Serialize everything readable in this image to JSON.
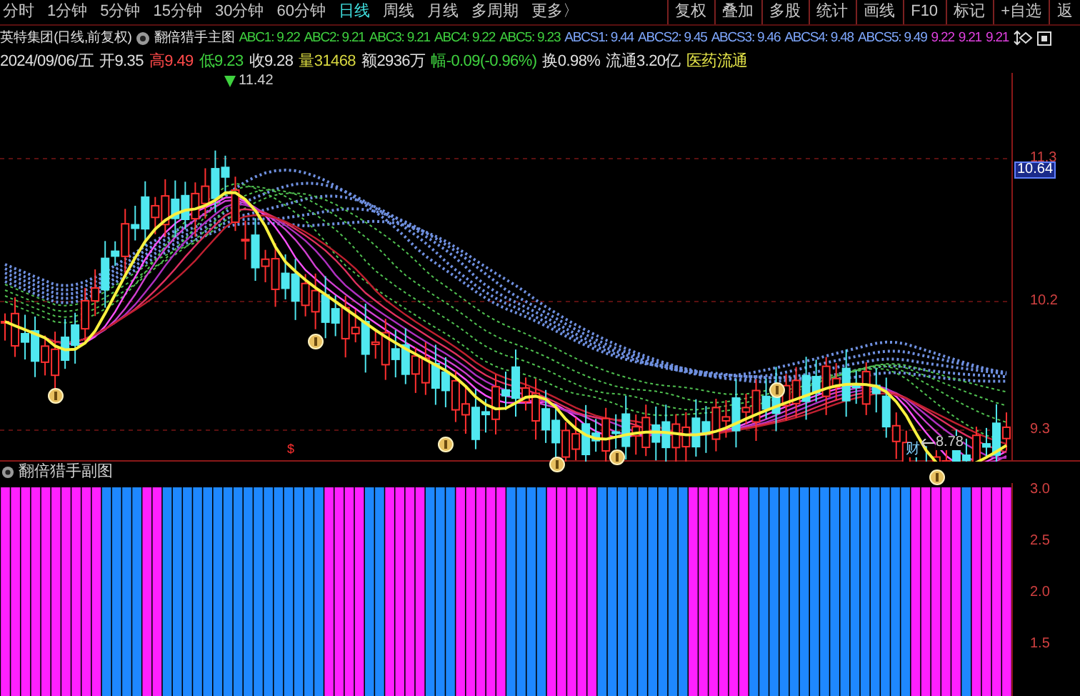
{
  "toolbar": {
    "periods": [
      {
        "label": "分时",
        "selected": false
      },
      {
        "label": "1分钟",
        "selected": false
      },
      {
        "label": "5分钟",
        "selected": false
      },
      {
        "label": "15分钟",
        "selected": false
      },
      {
        "label": "30分钟",
        "selected": false
      },
      {
        "label": "60分钟",
        "selected": false
      },
      {
        "label": "日线",
        "selected": true
      },
      {
        "label": "周线",
        "selected": false
      },
      {
        "label": "月线",
        "selected": false
      },
      {
        "label": "多周期",
        "selected": false
      },
      {
        "label": "更多〉",
        "selected": false
      }
    ],
    "buttons": [
      "复权",
      "叠加",
      "多股",
      "统计",
      "画线",
      "F10",
      "标记",
      "+自选",
      "返"
    ]
  },
  "main_chart": {
    "stock": "英特集团(日线,前复权)",
    "title": "翻倍猎手主图",
    "indicators": [
      {
        "text": "ABC1: 9.22",
        "color": "#3fd23f"
      },
      {
        "text": "ABC2: 9.21",
        "color": "#3fd23f"
      },
      {
        "text": "ABC3: 9.21",
        "color": "#3fd23f"
      },
      {
        "text": "ABC4: 9.22",
        "color": "#3fd23f"
      },
      {
        "text": "ABC5: 9.23",
        "color": "#3fd23f"
      },
      {
        "text": "ABCS1: 9.44",
        "color": "#7fa8ff"
      },
      {
        "text": "ABCS2: 9.45",
        "color": "#7fa8ff"
      },
      {
        "text": "ABCS3: 9.46",
        "color": "#7fa8ff"
      },
      {
        "text": "ABCS4: 9.48",
        "color": "#7fa8ff"
      },
      {
        "text": "ABCS5: 9.49",
        "color": "#7fa8ff"
      },
      {
        "text": "9.22",
        "color": "#e040e0"
      },
      {
        "text": "9.21",
        "color": "#e040e0"
      },
      {
        "text": "9.21",
        "color": "#e040e0"
      }
    ],
    "quote": [
      {
        "text": "2024/09/06/五",
        "color": "#e0e0e0"
      },
      {
        "text": "开9.35",
        "color": "#e0e0e0"
      },
      {
        "text": "高9.49",
        "color": "#ff4a4a"
      },
      {
        "text": "低9.23",
        "color": "#3fd23f"
      },
      {
        "text": "收9.28",
        "color": "#e0e0e0"
      },
      {
        "text": "量31468",
        "color": "#d8d840"
      },
      {
        "text": "额2936万",
        "color": "#e0e0e0"
      },
      {
        "text": "幅-0.09(-0.96%)",
        "color": "#3fd23f"
      },
      {
        "text": "换0.98%",
        "color": "#e0e0e0"
      },
      {
        "text": "流通3.20亿",
        "color": "#e0e0e0"
      },
      {
        "text": "医药流通",
        "color": "#e8e84a"
      }
    ],
    "high_label": "11.42",
    "low_label": "8.78",
    "low_mark": "财",
    "bottom_mark": "$",
    "axis_labels": [
      "11.3",
      "10.2",
      "9.3"
    ],
    "current_price": "10.64"
  },
  "sub_chart": {
    "title": "翻倍猎手副图",
    "axis_labels": [
      "3.0",
      "2.5",
      "2.0",
      "1.5"
    ]
  }
}
